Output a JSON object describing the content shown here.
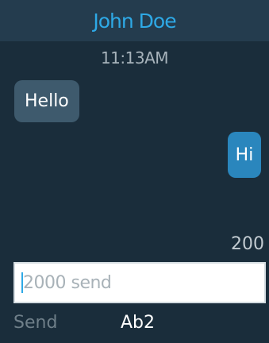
{
  "header": {
    "title": "John Doe"
  },
  "conversation": {
    "timestamp": "11:13AM",
    "messages": [
      {
        "direction": "incoming",
        "text": "Hello"
      },
      {
        "direction": "outgoing",
        "text": "Hi"
      }
    ]
  },
  "composer": {
    "char_counter": "200",
    "input_value": "2000 send"
  },
  "softkeys": {
    "left_label": "Send",
    "center_label": "Ab2"
  },
  "colors": {
    "background": "#1a2d3b",
    "header": "#243c4e",
    "accent": "#2ea9e6",
    "incoming_bubble": "#3e5a6d",
    "outgoing_bubble": "#2a86bd"
  }
}
